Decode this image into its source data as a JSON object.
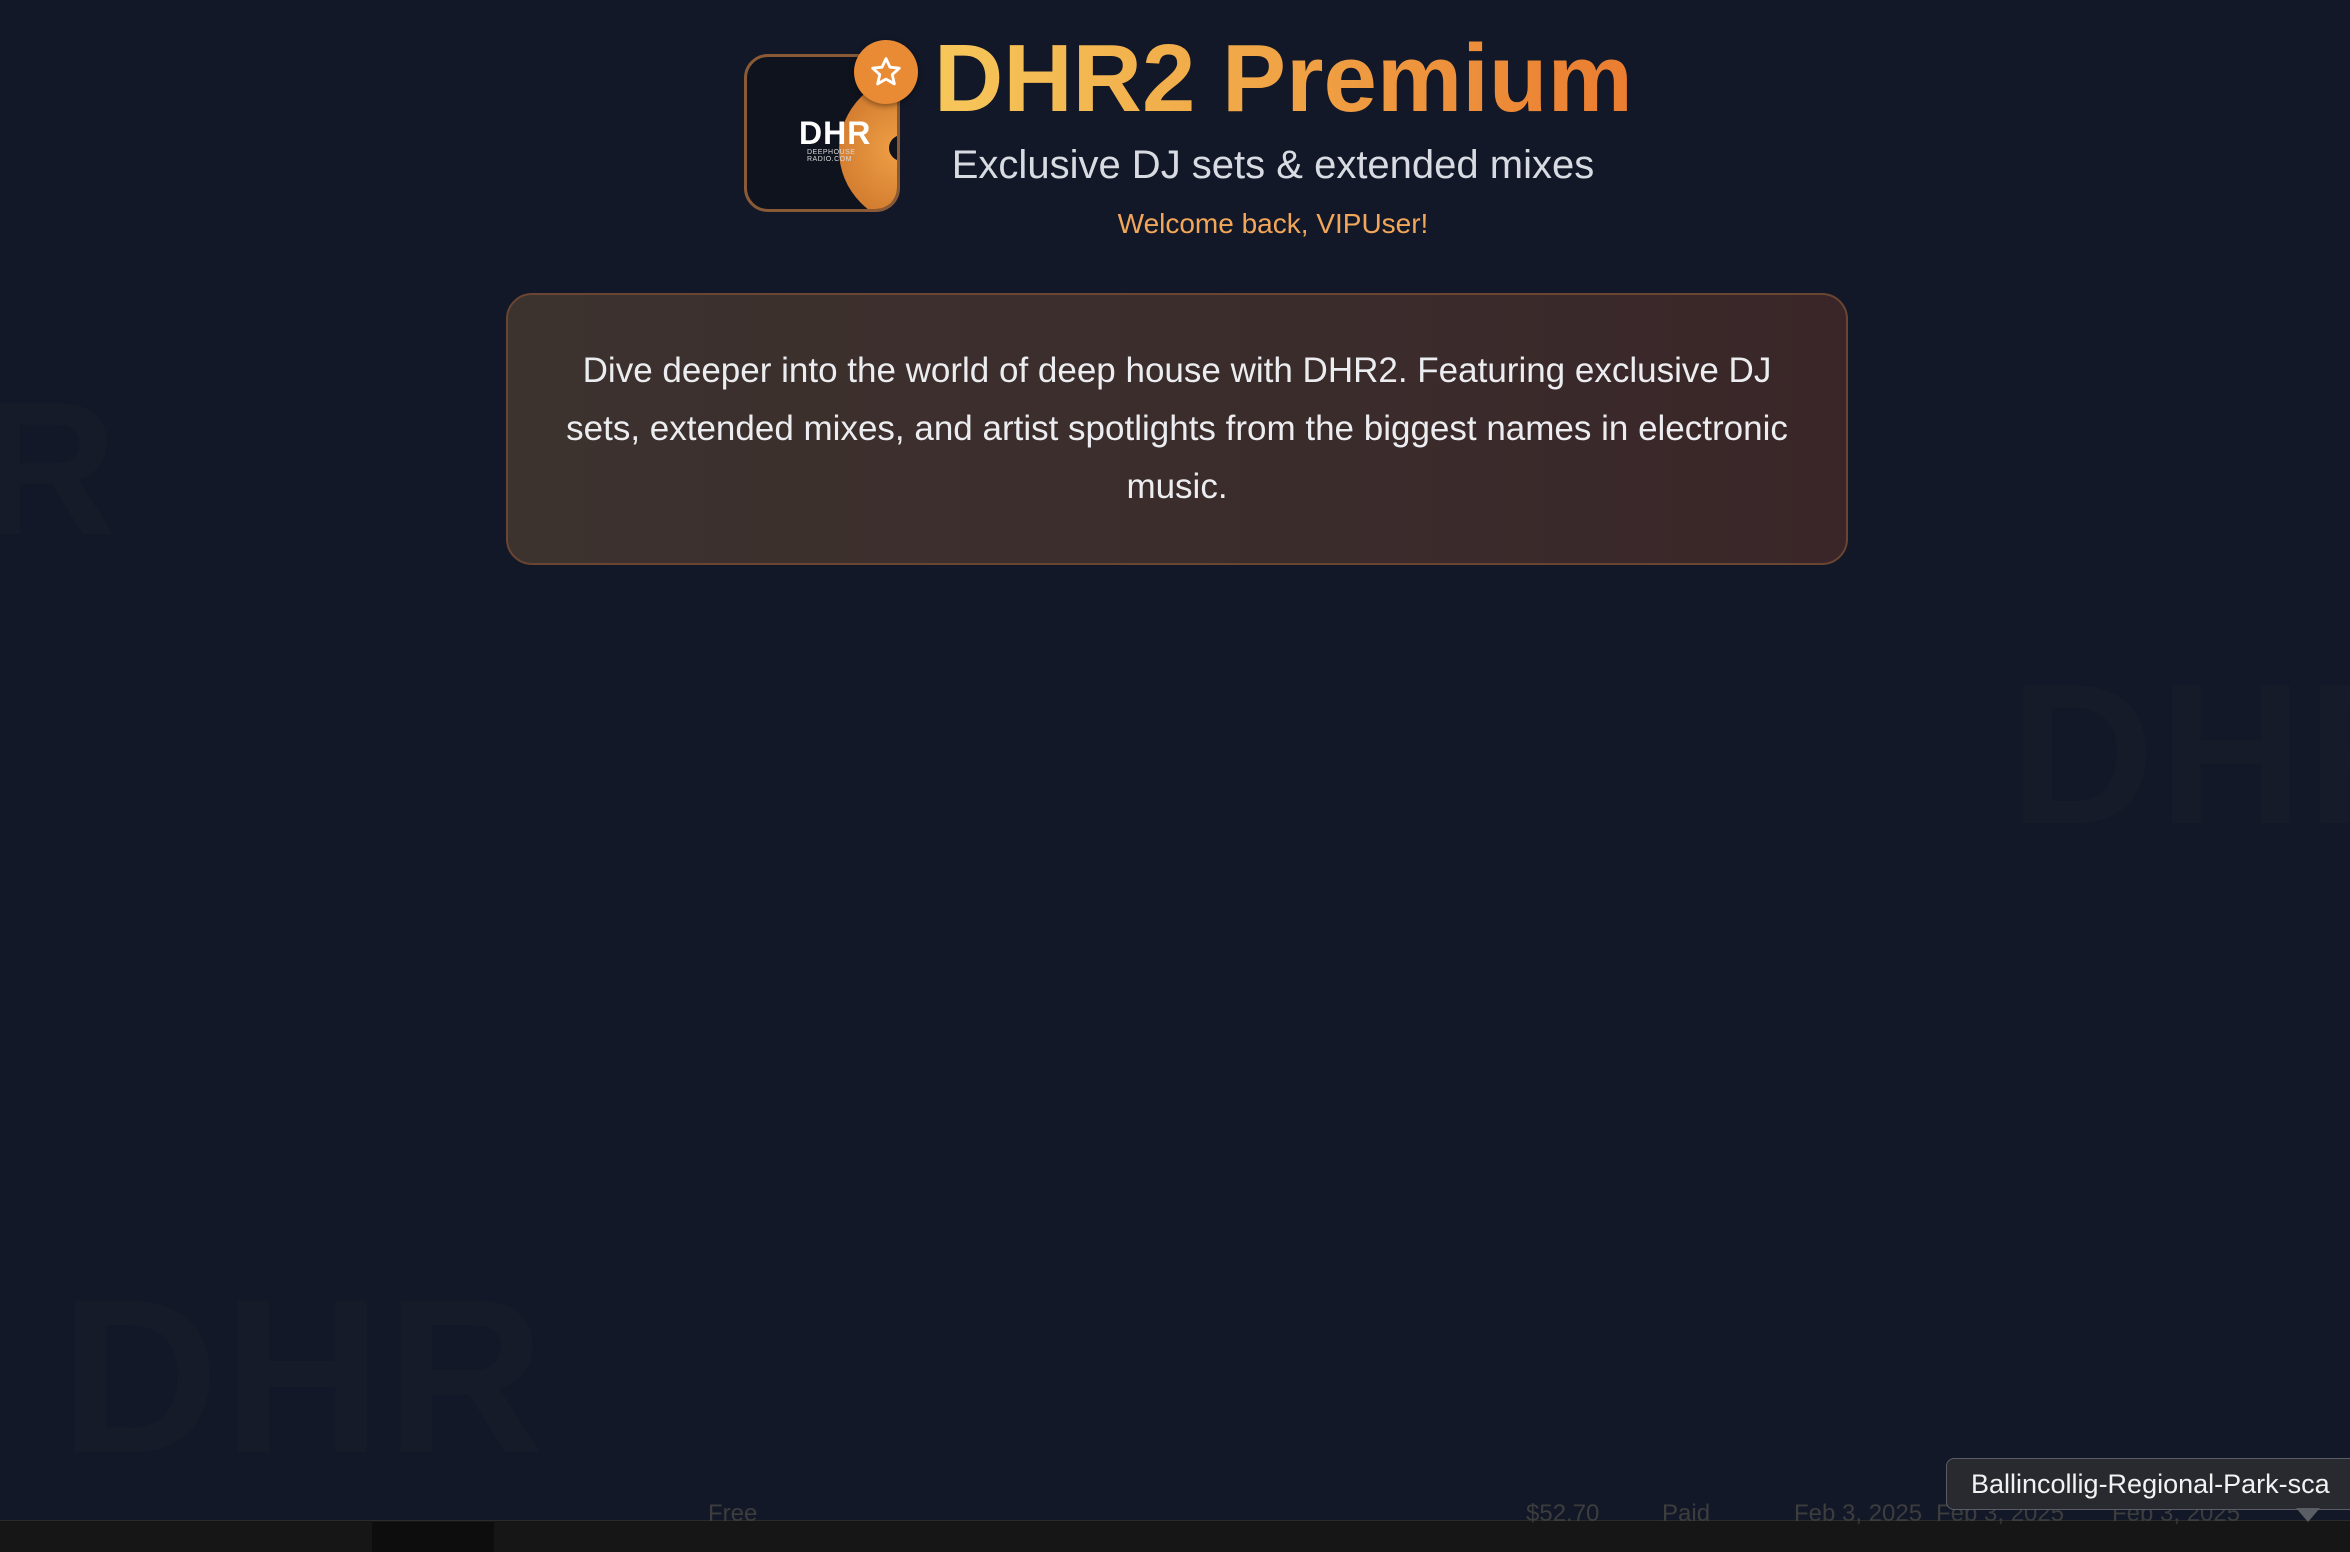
{
  "header": {
    "logo_text": "DHR",
    "logo_subtext": "DEEPHOUSE RADIO.COM",
    "title": "DHR2 Premium",
    "subtitle": "Exclusive DJ sets & extended mixes",
    "welcome": "Welcome back, VIPUser!",
    "badge_icon": "star-icon"
  },
  "card": {
    "text": "Dive deeper into the world of deep house with DHR2. Featuring exclusive DJ sets, extended mixes, and artist spotlights from the biggest names in electronic music."
  },
  "watermarks": {
    "text": "DHR"
  },
  "bottom_strip": {
    "items": [
      "Free",
      "$52.70",
      "Paid",
      "Feb 3, 2025",
      "Feb 3, 2025",
      "Feb 3, 2025"
    ]
  },
  "tooltip": {
    "text": "Ballincollig-Regional-Park-sca"
  },
  "colors": {
    "background": "#121827",
    "accent": "#f0a345",
    "card_border": "#6a4632"
  }
}
